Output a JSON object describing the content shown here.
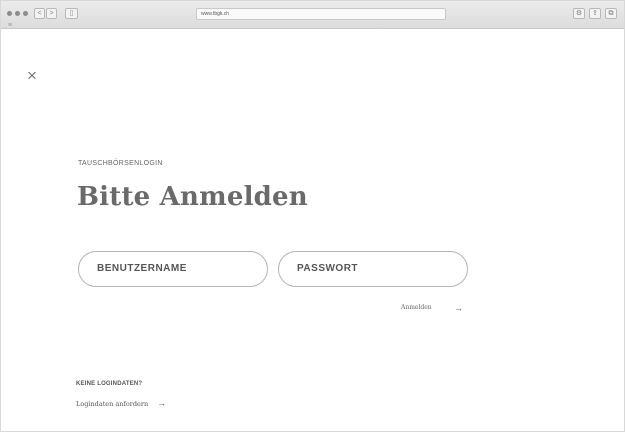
{
  "browser": {
    "url": "www.tbgk.ch",
    "back_label": "<",
    "forward_label": ">",
    "sidebar_label": "▯",
    "menu_label": "≡",
    "settings_label": "⚙",
    "share_label": "⇪",
    "tabs_label": "⧉"
  },
  "dialog": {
    "close_label": "×",
    "eyebrow": "TAUSCHBÖRSENLOGIN",
    "title": "Bitte Anmelden",
    "username_label": "BENUTZERNAME",
    "password_label": "PASSWORT",
    "login_label": "Anmelden",
    "arrow": "→",
    "no_login_label": "KEINE LOGINDATEN?",
    "request_label": "Logindaten anfordern"
  }
}
